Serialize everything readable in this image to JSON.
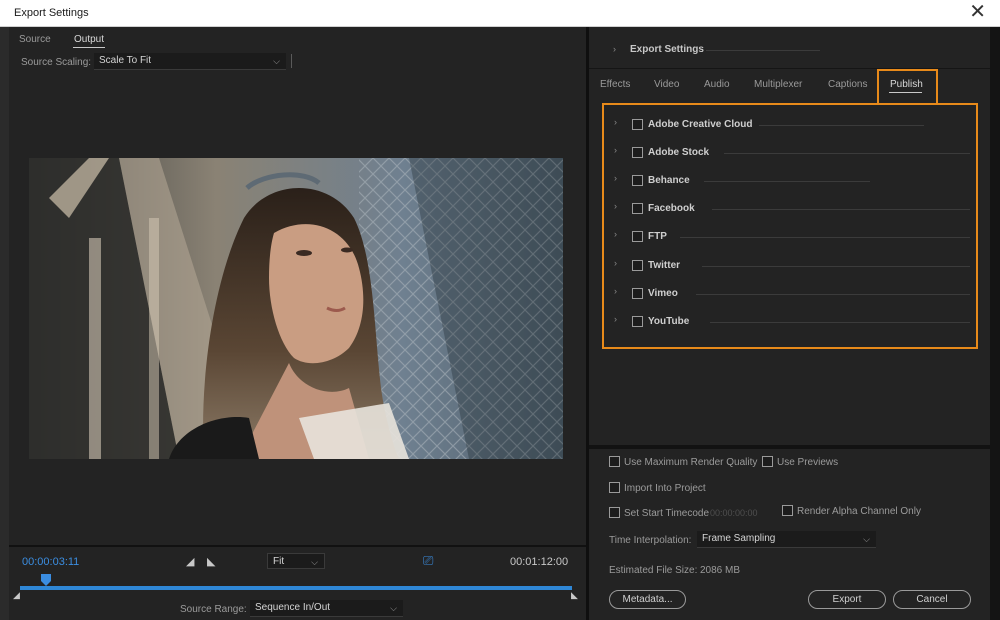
{
  "window": {
    "title": "Export Settings"
  },
  "left": {
    "tabs": [
      {
        "label": "Source"
      },
      {
        "label": "Output"
      }
    ],
    "source_scaling": {
      "label": "Source Scaling:",
      "value": "Scale To Fit"
    },
    "timeline": {
      "current_time": "00:00:03:11",
      "end_time": "00:01:12:00",
      "fit": "Fit",
      "source_range_label": "Source Range:",
      "source_range_value": "Sequence In/Out",
      "playhead_progress": 0.047
    }
  },
  "right": {
    "export_settings_header": "Export Settings",
    "tabs": [
      {
        "label": "Effects"
      },
      {
        "label": "Video"
      },
      {
        "label": "Audio"
      },
      {
        "label": "Multiplexer"
      },
      {
        "label": "Captions"
      },
      {
        "label": "Publish"
      }
    ],
    "active_tab": "Publish",
    "publish_destinations": [
      {
        "label": "Adobe Creative Cloud",
        "checked": false
      },
      {
        "label": "Adobe Stock",
        "checked": false
      },
      {
        "label": "Behance",
        "checked": false
      },
      {
        "label": "Facebook",
        "checked": false
      },
      {
        "label": "FTP",
        "checked": false
      },
      {
        "label": "Twitter",
        "checked": false
      },
      {
        "label": "Vimeo",
        "checked": false
      },
      {
        "label": "YouTube",
        "checked": false
      }
    ],
    "options": {
      "max_render_quality": "Use Maximum Render Quality",
      "use_previews": "Use Previews",
      "import_into_project": "Import Into Project",
      "set_start_timecode": "Set Start Timecode",
      "timecode_value": "00:00:00:00",
      "render_alpha": "Render Alpha Channel Only",
      "time_interpolation_label": "Time Interpolation:",
      "time_interpolation_value": "Frame Sampling",
      "file_size_label": "Estimated File Size:",
      "file_size_value": "2086 MB"
    },
    "buttons": {
      "metadata": "Metadata...",
      "export": "Export",
      "cancel": "Cancel"
    }
  },
  "colors": {
    "accent_orange": "#e88a1a",
    "timeline_blue": "#2f87d6"
  }
}
